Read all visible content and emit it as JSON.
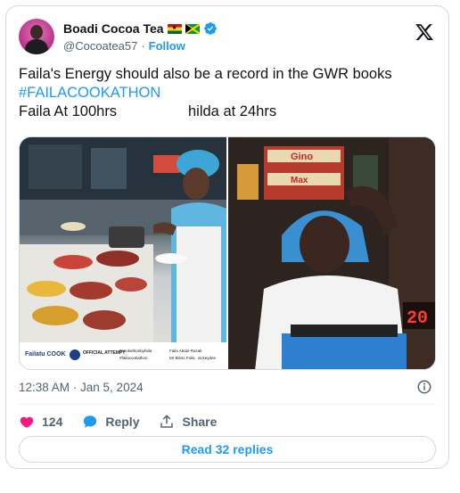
{
  "author": {
    "display_name": "Boadi Cocoa Tea",
    "handle": "@Cocoatea57",
    "separator": "·",
    "follow_label": "Follow",
    "flags": [
      "ghana-flag",
      "jamaica-flag"
    ],
    "verified_icon": "verified-badge-icon"
  },
  "tweet": {
    "line1": "Faila's Energy should also be a record in the GWR books",
    "hashtag": "#FAILACOOKATHON",
    "line3_left": "Faila At 100hrs",
    "line3_right": "hilda at 24hrs"
  },
  "media": {
    "left_caption_brand": "Failatu COOK",
    "left_caption_official": "OFFICIAL ATTEMPT",
    "left_caption_tags": [
      "#cookathonbyfaila",
      "#failacookathon"
    ],
    "left_caption_handles": [
      "Faila Abdul-Razak",
      "Mr Bless Faila",
      "sickeydee"
    ],
    "right_sign_top": "Gino",
    "right_sign_bottom": "Max",
    "right_clock": "20"
  },
  "meta": {
    "timestamp": "12:38 AM · Jan 5, 2024"
  },
  "actions": {
    "like_count": "124",
    "reply_label": "Reply",
    "share_label": "Share"
  },
  "read_replies_label": "Read 32 replies",
  "colors": {
    "accent": "#1d9bf0",
    "like": "#f91880",
    "text": "#0f1419",
    "muted": "#536471"
  }
}
